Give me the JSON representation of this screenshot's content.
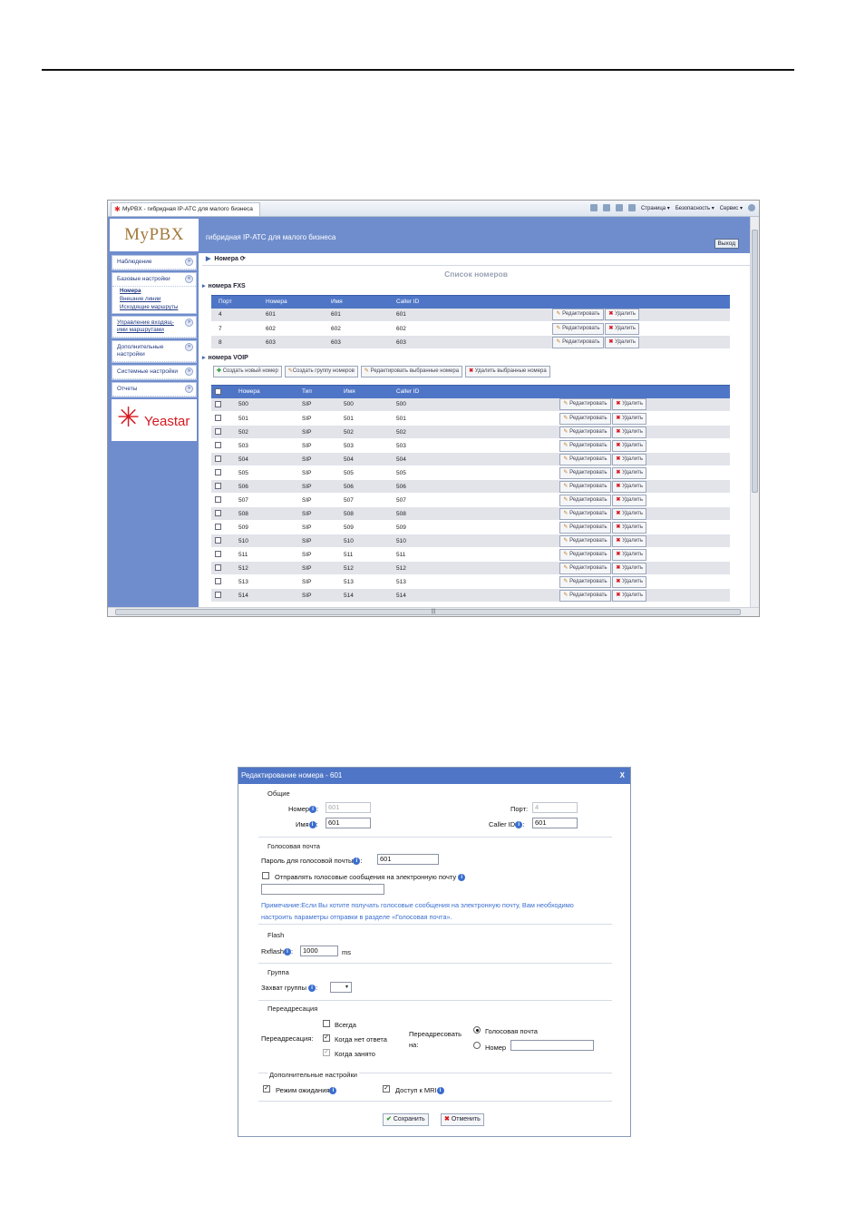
{
  "browser": {
    "tab_title": "MyPBX - гибридная IP-АТС для малого бизнеса",
    "toolbar": [
      "Страница ▾",
      "Безопасность ▾",
      "Сервис ▾"
    ],
    "hscroll_mark": "|||"
  },
  "app": {
    "logo": "MyPBX",
    "subtitle": "гибридная IP-АТС для малого бизнеса",
    "logout": "Выход",
    "brand": "Yeastar"
  },
  "sidebar": {
    "monitoring": "Наблюдение",
    "basic": "Базовые настройки",
    "basic_items": [
      "Номера",
      "Внешние линии",
      "Исходящие маршруты"
    ],
    "inbound": "Управление входящ-ими маршрутами",
    "advanced": "Дополнительные настройки",
    "system": "Системные настройки",
    "reports": "Отчеты"
  },
  "main": {
    "breadcrumb": "Номера",
    "list_title": "Список номеров",
    "fxs_title": "номера FXS",
    "voip_title": "номера VOIP",
    "edit_label": "Редактировать",
    "delete_label": "Удалить",
    "fxs_headers": [
      "Порт",
      "Номера",
      "Имя",
      "Caller ID"
    ],
    "fxs_rows": [
      [
        "4",
        "601",
        "601",
        "601"
      ],
      [
        "7",
        "602",
        "602",
        "602"
      ],
      [
        "8",
        "603",
        "603",
        "603"
      ]
    ],
    "voip_actions": [
      "Создать новый номер",
      "Создать группу номеров",
      "Редактировать выбранные номера",
      "Удалить выбранные номера"
    ],
    "voip_headers": [
      "Номера",
      "Тип",
      "Имя",
      "Caller ID"
    ],
    "voip_rows": [
      [
        "500",
        "SIP",
        "500",
        "500"
      ],
      [
        "501",
        "SIP",
        "501",
        "501"
      ],
      [
        "502",
        "SIP",
        "502",
        "502"
      ],
      [
        "503",
        "SIP",
        "503",
        "503"
      ],
      [
        "504",
        "SIP",
        "504",
        "504"
      ],
      [
        "505",
        "SIP",
        "505",
        "505"
      ],
      [
        "506",
        "SIP",
        "506",
        "506"
      ],
      [
        "507",
        "SIP",
        "507",
        "507"
      ],
      [
        "508",
        "SIP",
        "508",
        "508"
      ],
      [
        "509",
        "SIP",
        "509",
        "509"
      ],
      [
        "510",
        "SIP",
        "510",
        "510"
      ],
      [
        "511",
        "SIP",
        "511",
        "511"
      ],
      [
        "512",
        "SIP",
        "512",
        "512"
      ],
      [
        "513",
        "SIP",
        "513",
        "513"
      ],
      [
        "514",
        "SIP",
        "514",
        "514"
      ]
    ]
  },
  "dialog": {
    "title": "Редактирование номера - 601",
    "close": "X",
    "general": "Общие",
    "number_label": "Номер",
    "number_value": "601",
    "port_label": "Порт:",
    "port_value": "4",
    "name_label": "Имя",
    "name_value": "601",
    "callerid_label": "Caller ID",
    "callerid_value": "601",
    "voicemail": "Голосовая почта",
    "vm_pass_label": "Пароль для голосовой почты",
    "vm_pass_value": "601",
    "vm_email_label": "Отправлять голосовые сообщения на электронную почту",
    "note": "Примечание:Если Вы хотите получать голосовые сообщения на электронную почту, Вам необходимо настроить параметры отправки в разделе «Голосовая почта».",
    "flash": "Flash",
    "rxflash_label": "Rxflash",
    "rxflash_value": "1000",
    "rxflash_unit": "ms",
    "group": "Группа",
    "pickup_label": "Захват группы",
    "forward": "Переадресация",
    "forward_label": "Переадресация:",
    "fw_always": "Всегда",
    "fw_noanswer": "Когда нет ответа",
    "fw_busy": "Когда занято",
    "fw_to_label": "Переадресовать на:",
    "fw_to_vm": "Голосовая почта",
    "fw_to_number": "Номер",
    "advanced": "Дополнительные настройки",
    "callwaiting": "Режим ожидания",
    "mri": "Доступ к MRI",
    "save": "Сохранить",
    "cancel": "Отменить"
  }
}
